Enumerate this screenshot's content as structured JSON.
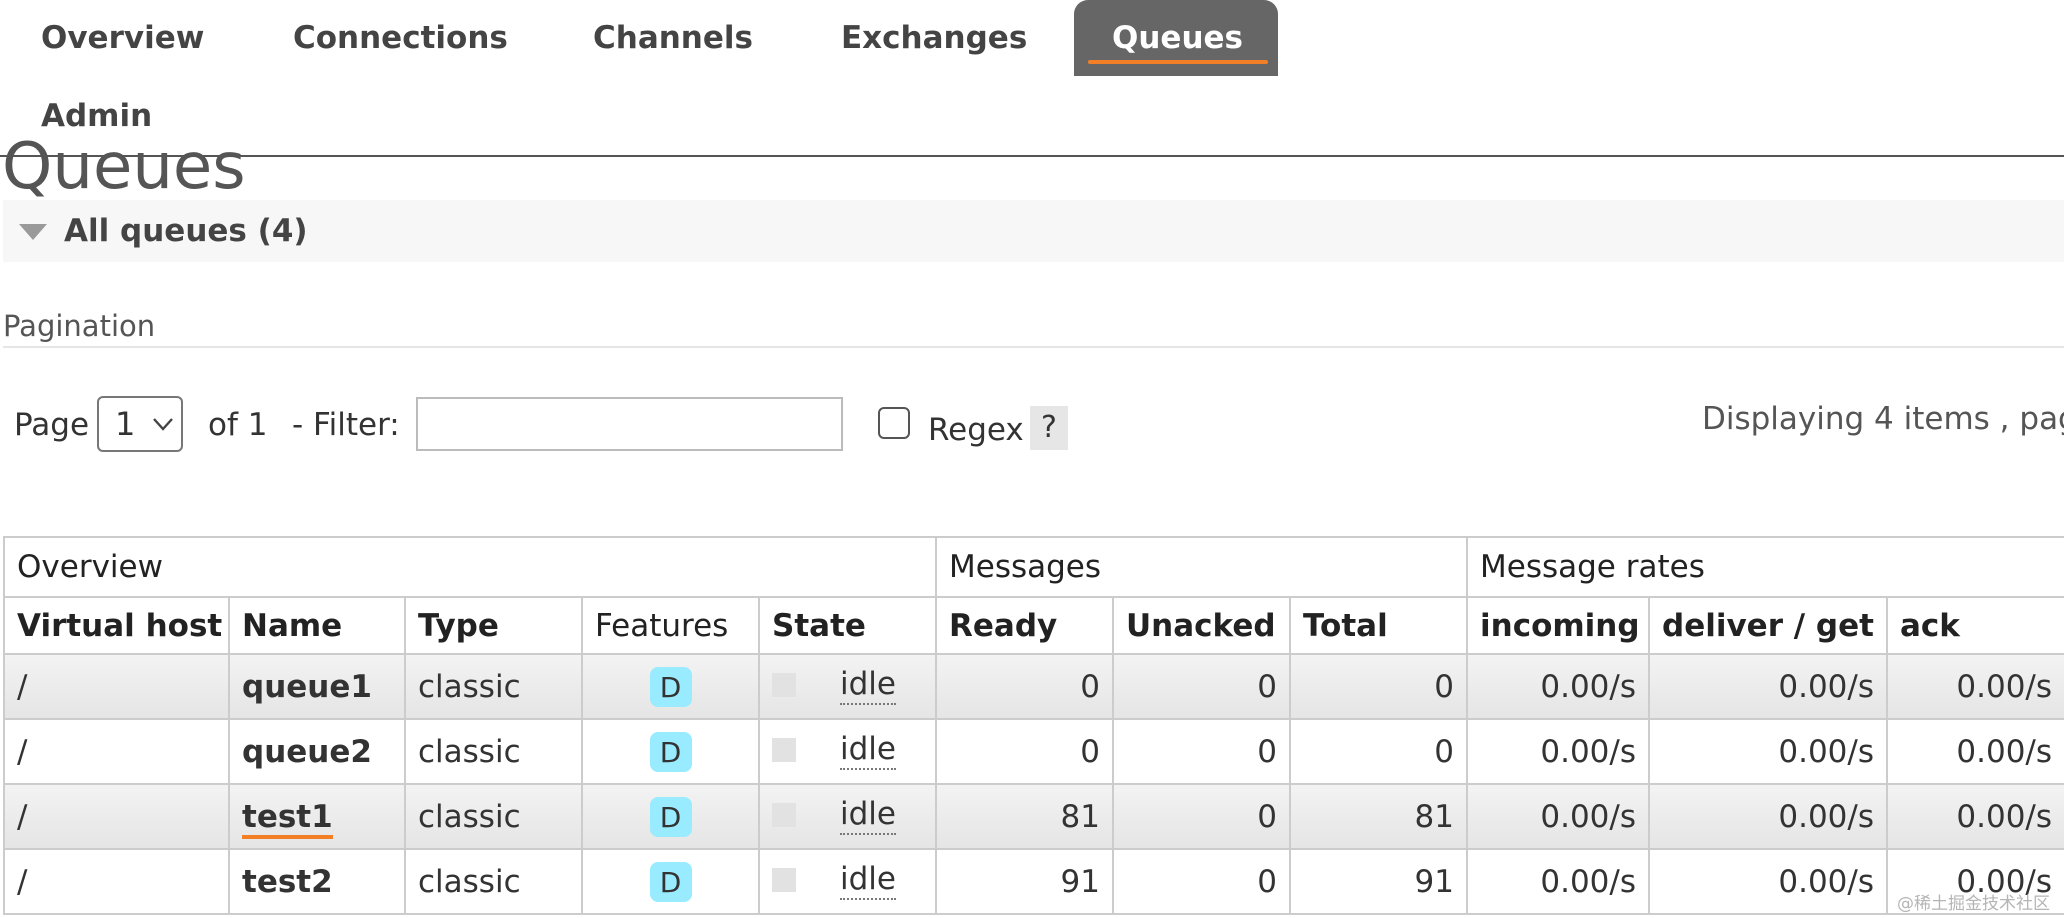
{
  "nav": {
    "items": [
      {
        "label": "Overview",
        "active": false
      },
      {
        "label": "Connections",
        "active": false
      },
      {
        "label": "Channels",
        "active": false
      },
      {
        "label": "Exchanges",
        "active": false
      },
      {
        "label": "Queues",
        "active": true
      },
      {
        "label": "Admin",
        "active": false
      }
    ]
  },
  "page_title": "Queues",
  "section": {
    "title": "All queues (4)"
  },
  "pagination": {
    "heading": "Pagination",
    "page_label": "Page",
    "page_value": "1",
    "of_label": "of 1",
    "filter_label": "- Filter:",
    "filter_value": "",
    "regex_label": "Regex",
    "regex_checked": false,
    "help_label": "?",
    "displaying_text": "Displaying 4 items , pag"
  },
  "table": {
    "groups": [
      "Overview",
      "Messages",
      "Message rates"
    ],
    "columns": [
      "Virtual host",
      "Name",
      "Type",
      "Features",
      "State",
      "Ready",
      "Unacked",
      "Total",
      "incoming",
      "deliver / get",
      "ack"
    ],
    "rows": [
      {
        "vhost": "/",
        "name": "queue1",
        "type": "classic",
        "features": "D",
        "state": "idle",
        "ready": "0",
        "unacked": "0",
        "total": "0",
        "incoming": "0.00/s",
        "deliver_get": "0.00/s",
        "ack": "0.00/s"
      },
      {
        "vhost": "/",
        "name": "queue2",
        "type": "classic",
        "features": "D",
        "state": "idle",
        "ready": "0",
        "unacked": "0",
        "total": "0",
        "incoming": "0.00/s",
        "deliver_get": "0.00/s",
        "ack": "0.00/s"
      },
      {
        "vhost": "/",
        "name": "test1",
        "type": "classic",
        "features": "D",
        "state": "idle",
        "ready": "81",
        "unacked": "0",
        "total": "81",
        "incoming": "0.00/s",
        "deliver_get": "0.00/s",
        "ack": "0.00/s"
      },
      {
        "vhost": "/",
        "name": "test2",
        "type": "classic",
        "features": "D",
        "state": "idle",
        "ready": "91",
        "unacked": "0",
        "total": "91",
        "incoming": "0.00/s",
        "deliver_get": "0.00/s",
        "ack": "0.00/s"
      }
    ]
  },
  "watermark": "@稀土掘金技术社区",
  "colors": {
    "accent": "#f27f26",
    "active_tab": "#666666",
    "feature_badge": "#99ebff"
  }
}
